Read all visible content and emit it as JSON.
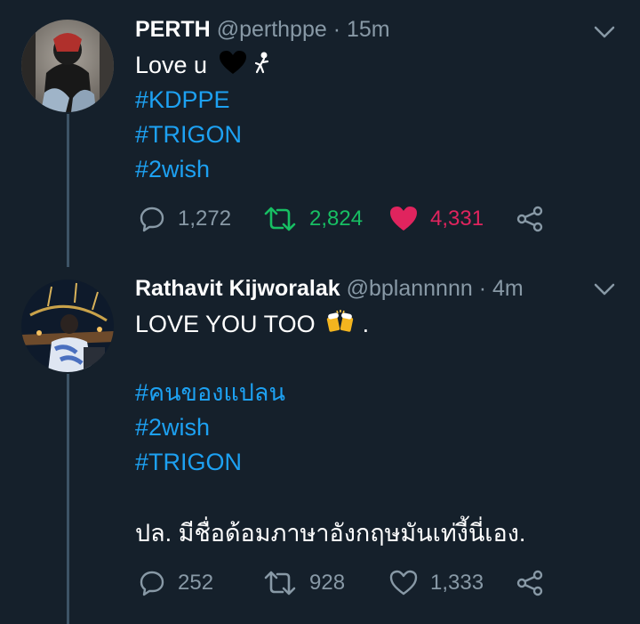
{
  "tweets": [
    {
      "author": "PERTH",
      "handle": "@perthppe",
      "separator": "·",
      "time": "15m",
      "text_prefix": "Love u",
      "hashtags": [
        "#KDPPE",
        "#TRIGON",
        "#2wish"
      ],
      "stats": {
        "replies": "1,272",
        "retweets": "2,824",
        "likes": "4,331",
        "retweeted": true,
        "liked": true
      },
      "colors": {
        "retweet_active": "#17bf63",
        "like_active": "#e0245e"
      },
      "icons": [
        "black-heart-icon",
        "dancer-icon"
      ]
    },
    {
      "author": "Rathavit Kijworalak",
      "handle": "@bplannnnn",
      "separator": "·",
      "time": "4m",
      "text_prefix": "LOVE YOU TOO",
      "text_suffix": ".",
      "hashtags": [
        "#คนของแปลน",
        "#2wish",
        "#TRIGON"
      ],
      "footer_text": "ปล. มีชื่อด้อมภาษาอังกฤษมันเท่งี้นี่เอง.",
      "stats": {
        "replies": "252",
        "retweets": "928",
        "likes": "1,333",
        "retweeted": false,
        "liked": false
      },
      "icons": [
        "beer-mugs-icon"
      ]
    }
  ],
  "theme": {
    "background": "#15202b",
    "secondary_text": "#8899a6",
    "link": "#1da1f2",
    "thread_line": "#3d5466"
  }
}
